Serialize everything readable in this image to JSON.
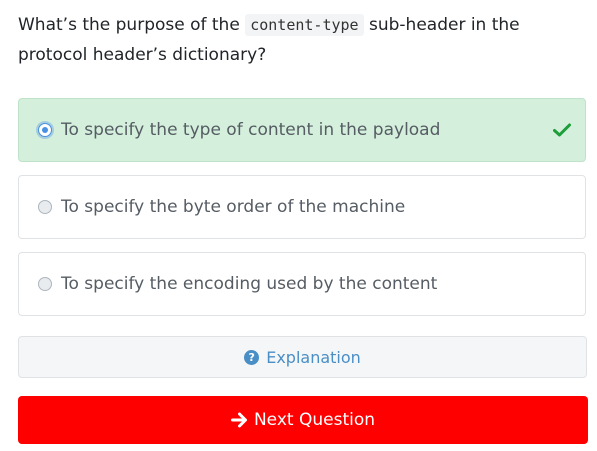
{
  "question": {
    "before": "What’s the purpose of the ",
    "code": "content-type",
    "after": " sub-header in the protocol header’s dictionary?"
  },
  "options": [
    {
      "label": "To specify the type of content in the payload",
      "selected": true,
      "correct": true
    },
    {
      "label": "To specify the byte order of the machine",
      "selected": false,
      "correct": false
    },
    {
      "label": "To specify the encoding used by the content",
      "selected": false,
      "correct": false
    }
  ],
  "explanation": {
    "label": "Explanation",
    "icon": "question-circle-icon"
  },
  "next": {
    "label": "Next Question",
    "icon": "arrow-right-icon"
  },
  "colors": {
    "correct_bg": "#d4efdc",
    "check": "#1e9e3a",
    "next_bg": "#ff0000",
    "link": "#4a8ec6"
  }
}
